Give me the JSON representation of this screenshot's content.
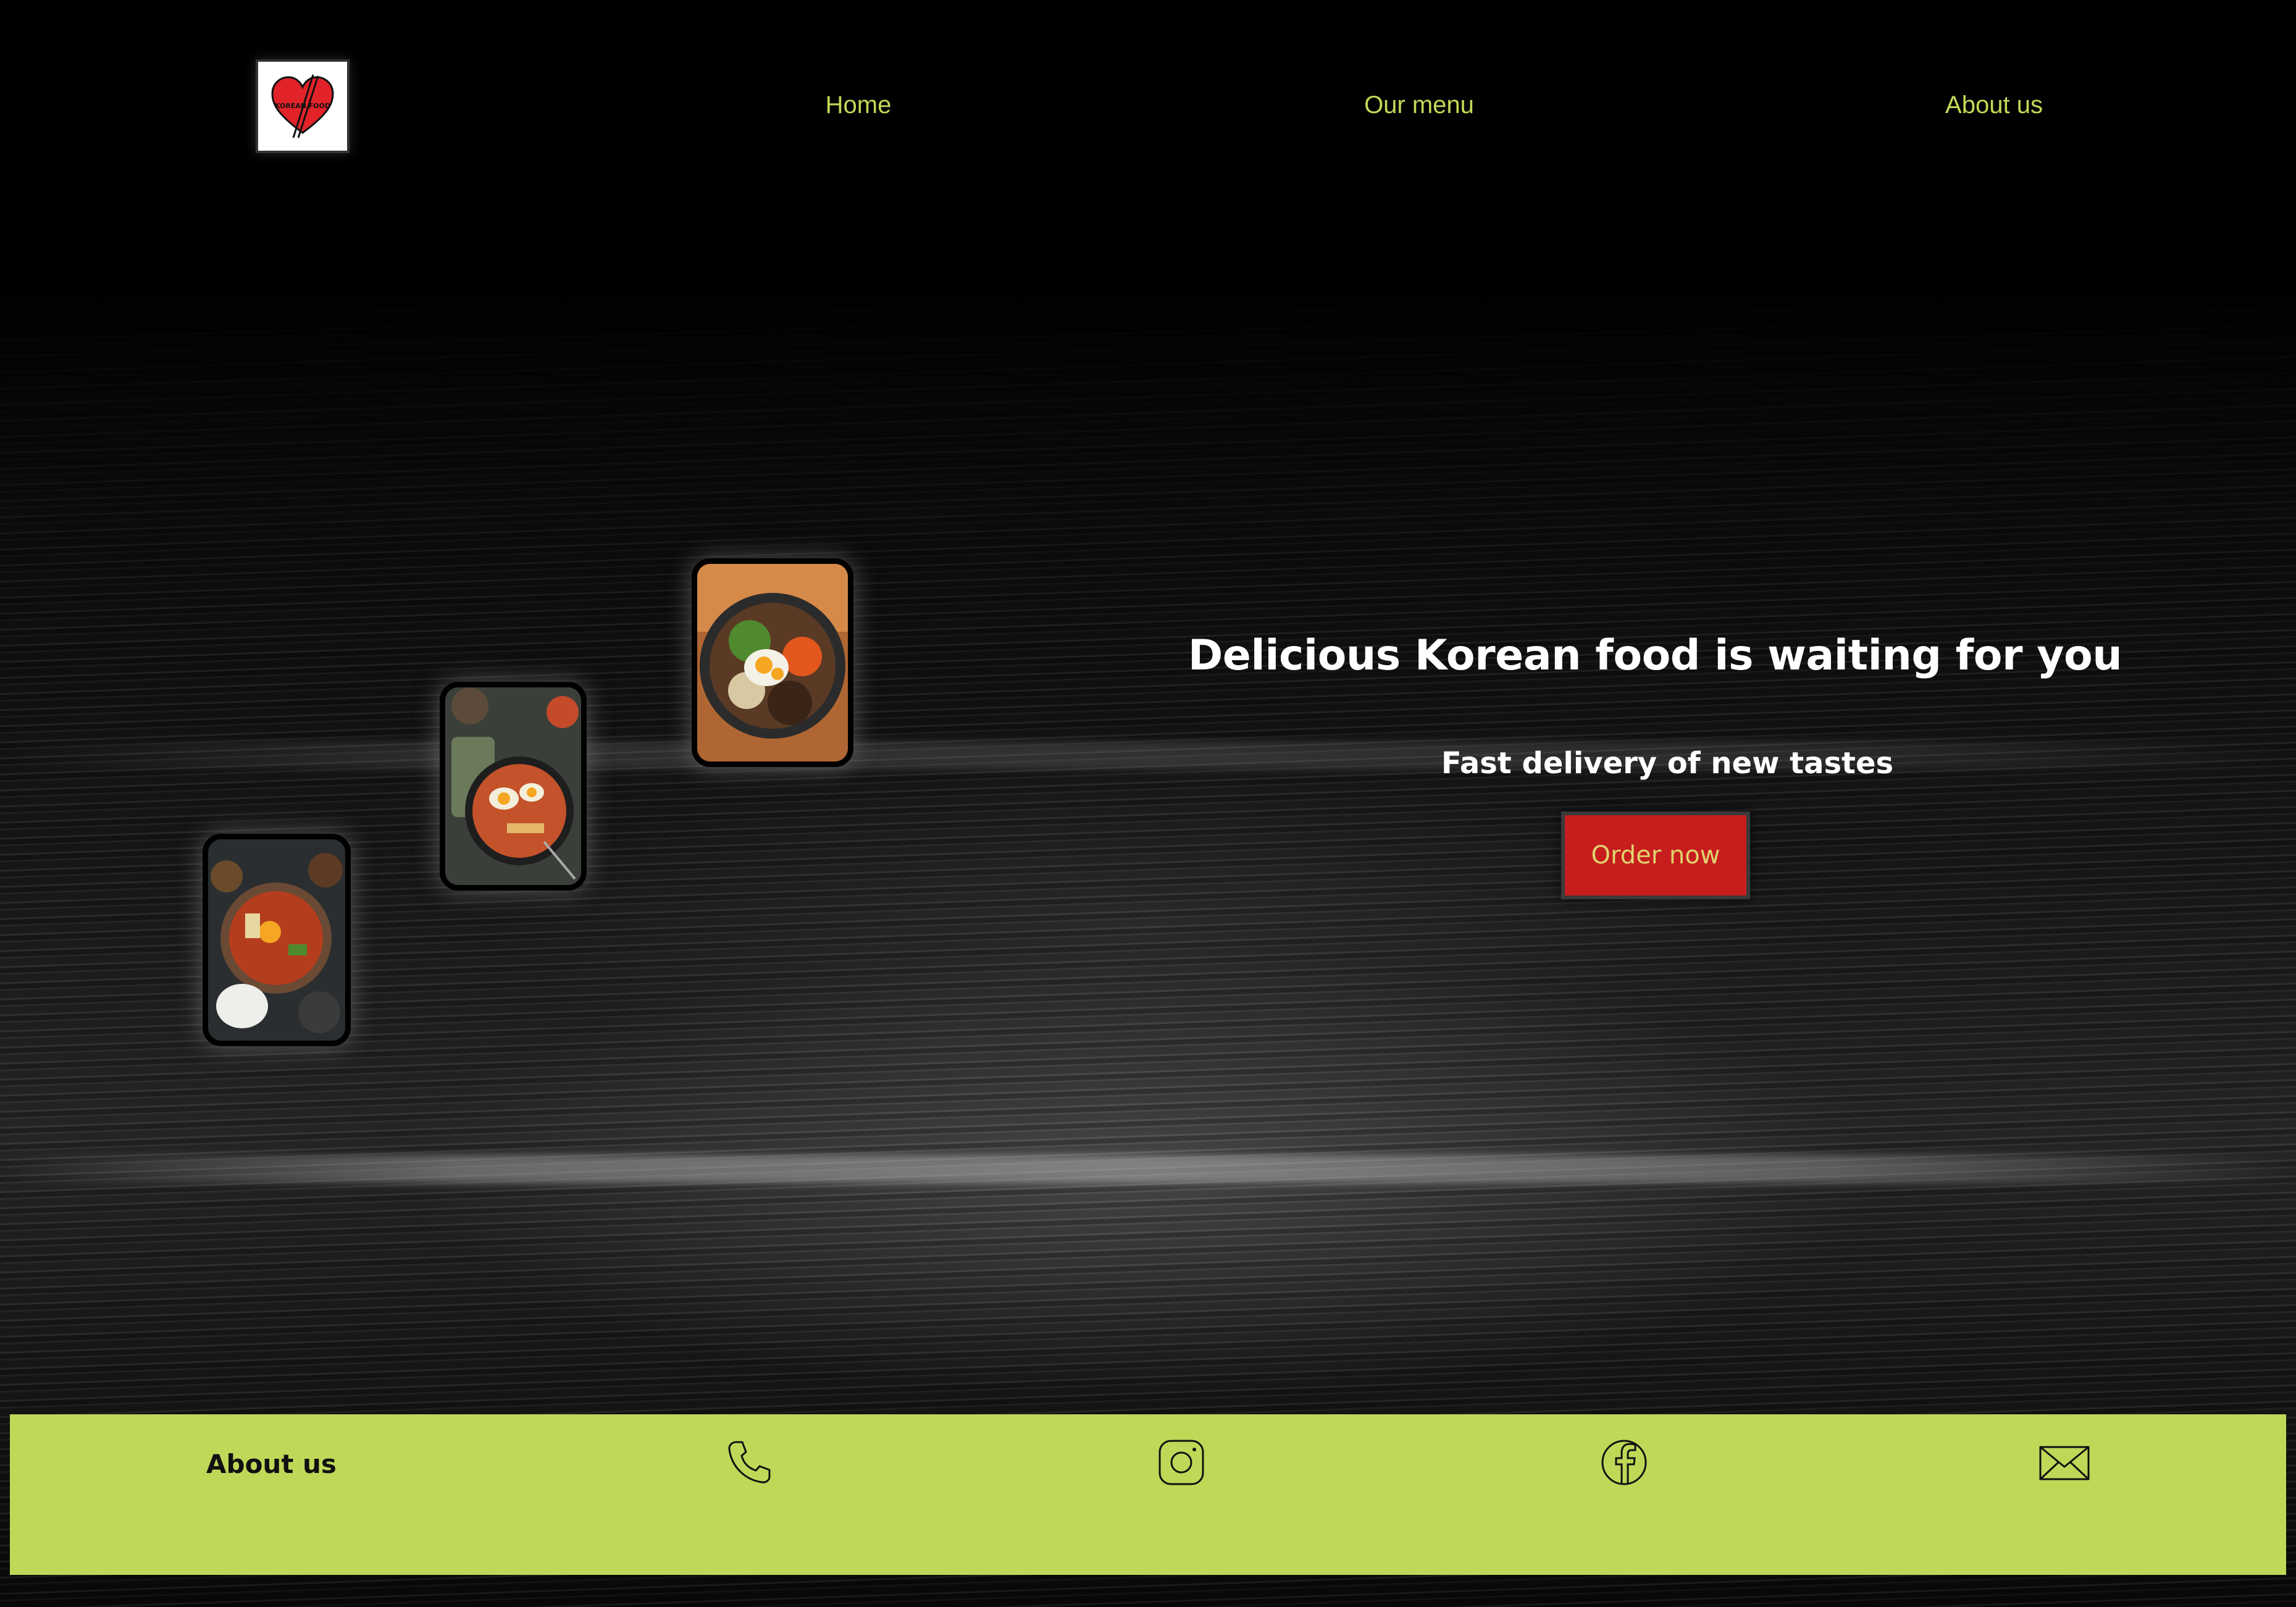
{
  "header": {
    "logo_text": "KOREAN FOOD",
    "nav": [
      {
        "label": "Home"
      },
      {
        "label": "Our menu"
      },
      {
        "label": "About us"
      }
    ]
  },
  "hero": {
    "title": "Delicious Korean food is waiting for you",
    "subtitle": "Fast delivery of new tastes",
    "cta_label": "Order now"
  },
  "food_images": [
    "bibimbap-icon",
    "ramen-icon",
    "stew-icon"
  ],
  "footer": {
    "title": "About us",
    "icons": [
      "phone-icon",
      "instagram-icon",
      "facebook-icon",
      "mail-icon"
    ]
  },
  "colors": {
    "accent": "#c0d858",
    "nav_text": "#c2da57",
    "button_bg": "#c71d1d",
    "button_text": "#e0d36e",
    "background": "#000000"
  }
}
